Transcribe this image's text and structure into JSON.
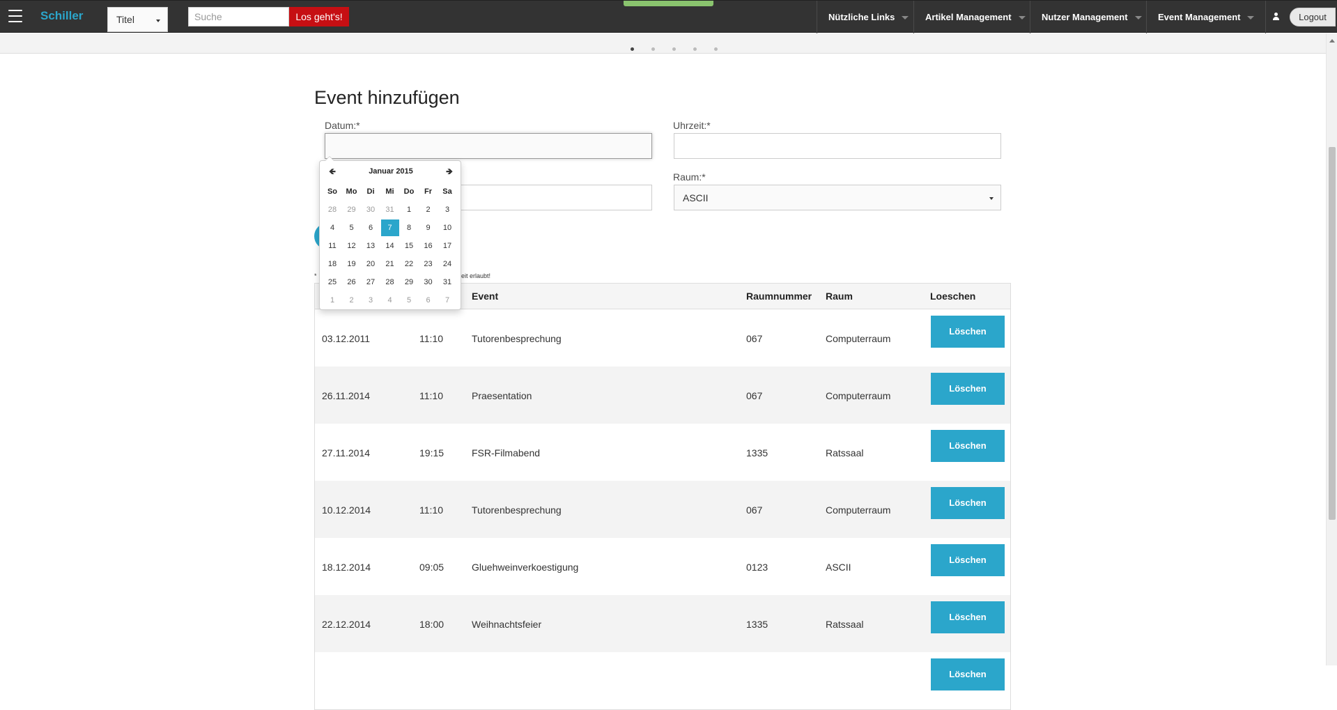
{
  "nav": {
    "brand": "Schiller",
    "search_type": "Titel",
    "search_placeholder": "Suche",
    "go_label": "Los geht's!",
    "menus": [
      "Nützliche Links",
      "Artikel Management",
      "Nutzer Management",
      "Event Management"
    ],
    "logout_label": "Logout"
  },
  "carousel": {
    "dot_count": 5,
    "active_index": 0
  },
  "form": {
    "title": "Event hinzufügen",
    "date_label": "Datum:*",
    "date_value": "",
    "time_label": "Uhrzeit:*",
    "time_value": "",
    "event_value": "",
    "room_label": "Raum:*",
    "room_value": "ASCII",
    "note_start": "*",
    "note_end": "eit erlaubt!"
  },
  "datepicker": {
    "month_title": "Januar 2015",
    "weekdays": [
      "So",
      "Mo",
      "Di",
      "Mi",
      "Do",
      "Fr",
      "Sa"
    ],
    "weeks": [
      [
        "28",
        "29",
        "30",
        "31",
        "1",
        "2",
        "3"
      ],
      [
        "4",
        "5",
        "6",
        "7",
        "8",
        "9",
        "10"
      ],
      [
        "11",
        "12",
        "13",
        "14",
        "15",
        "16",
        "17"
      ],
      [
        "18",
        "19",
        "20",
        "21",
        "22",
        "23",
        "24"
      ],
      [
        "25",
        "26",
        "27",
        "28",
        "29",
        "30",
        "31"
      ],
      [
        "1",
        "2",
        "3",
        "4",
        "5",
        "6",
        "7"
      ]
    ],
    "active_day": "7"
  },
  "table": {
    "headers": [
      "Event",
      "Raumnummer",
      "Raum",
      "Loeschen"
    ],
    "delete_label": "Löschen",
    "rows": [
      {
        "date": "03.12.2011",
        "time": "11:10",
        "event": "Tutorenbesprechung",
        "room_number": "067",
        "room": "Computerraum"
      },
      {
        "date": "26.11.2014",
        "time": "11:10",
        "event": "Praesentation",
        "room_number": "067",
        "room": "Computerraum"
      },
      {
        "date": "27.11.2014",
        "time": "19:15",
        "event": "FSR-Filmabend",
        "room_number": "1335",
        "room": "Ratssaal"
      },
      {
        "date": "10.12.2014",
        "time": "11:10",
        "event": "Tutorenbesprechung",
        "room_number": "067",
        "room": "Computerraum"
      },
      {
        "date": "18.12.2014",
        "time": "09:05",
        "event": "Gluehweinverkoestigung",
        "room_number": "0123",
        "room": "ASCII"
      },
      {
        "date": "22.12.2014",
        "time": "18:00",
        "event": "Weihnachtsfeier",
        "room_number": "1335",
        "room": "Ratssaal"
      },
      {
        "date": "",
        "time": "",
        "event": "",
        "room_number": "",
        "room": ""
      }
    ]
  }
}
